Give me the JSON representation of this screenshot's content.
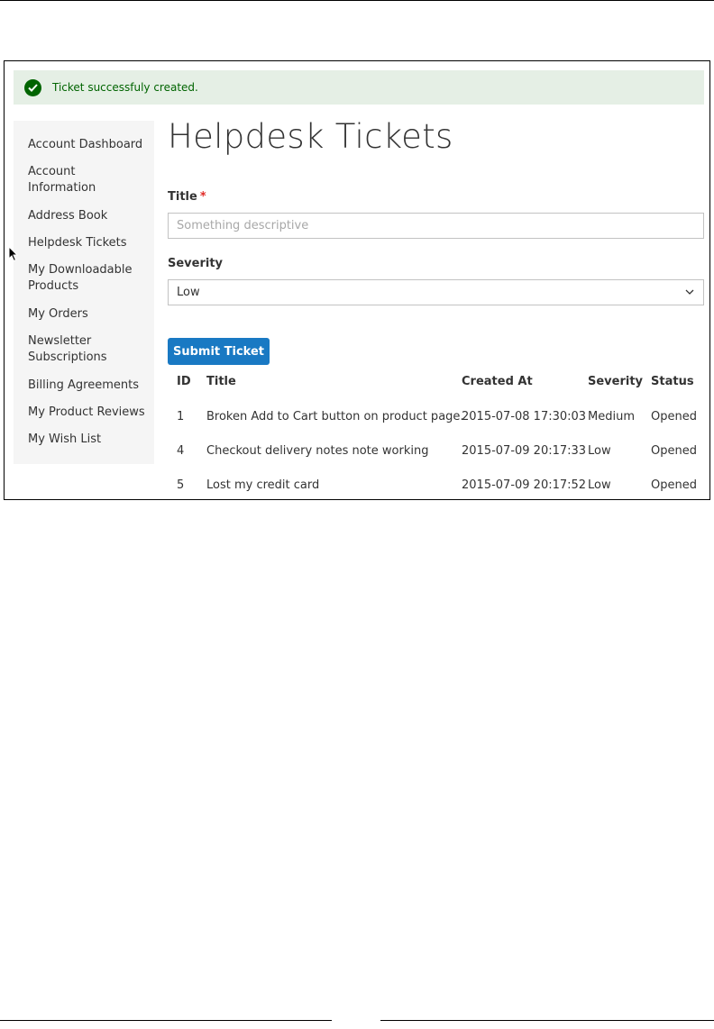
{
  "message": {
    "text": "Ticket successfuly created.",
    "icon": "check-circle-icon",
    "color": "#006400"
  },
  "sidebar": {
    "items": [
      {
        "label": "Account Dashboard"
      },
      {
        "label": "Account Information"
      },
      {
        "label": "Address Book"
      },
      {
        "label": "Helpdesk Tickets"
      },
      {
        "label": "My Downloadable Products"
      },
      {
        "label": "My Orders"
      },
      {
        "label": "Newsletter Subscriptions"
      },
      {
        "label": "Billing Agreements"
      },
      {
        "label": "My Product Reviews"
      },
      {
        "label": "My Wish List"
      }
    ]
  },
  "page": {
    "title": "Helpdesk Tickets"
  },
  "form": {
    "title_label": "Title",
    "required_mark": "*",
    "title_placeholder": "Something descriptive",
    "severity_label": "Severity",
    "severity_value": "Low",
    "submit_label": "Submit Ticket"
  },
  "table": {
    "headers": [
      "ID",
      "Title",
      "Created At",
      "Severity",
      "Status"
    ],
    "rows": [
      [
        "1",
        "Broken Add to Cart button on product page.",
        "2015-07-08 17:30:03",
        "Medium",
        "Opened"
      ],
      [
        "4",
        "Checkout delivery notes note working",
        "2015-07-09 20:17:33",
        "Low",
        "Opened"
      ],
      [
        "5",
        "Lost my credit card",
        "2015-07-09 20:17:52",
        "Low",
        "Opened"
      ]
    ]
  },
  "colors": {
    "accent": "#1979c3",
    "success_bg": "#e5efe5",
    "required": "#e02b27"
  }
}
